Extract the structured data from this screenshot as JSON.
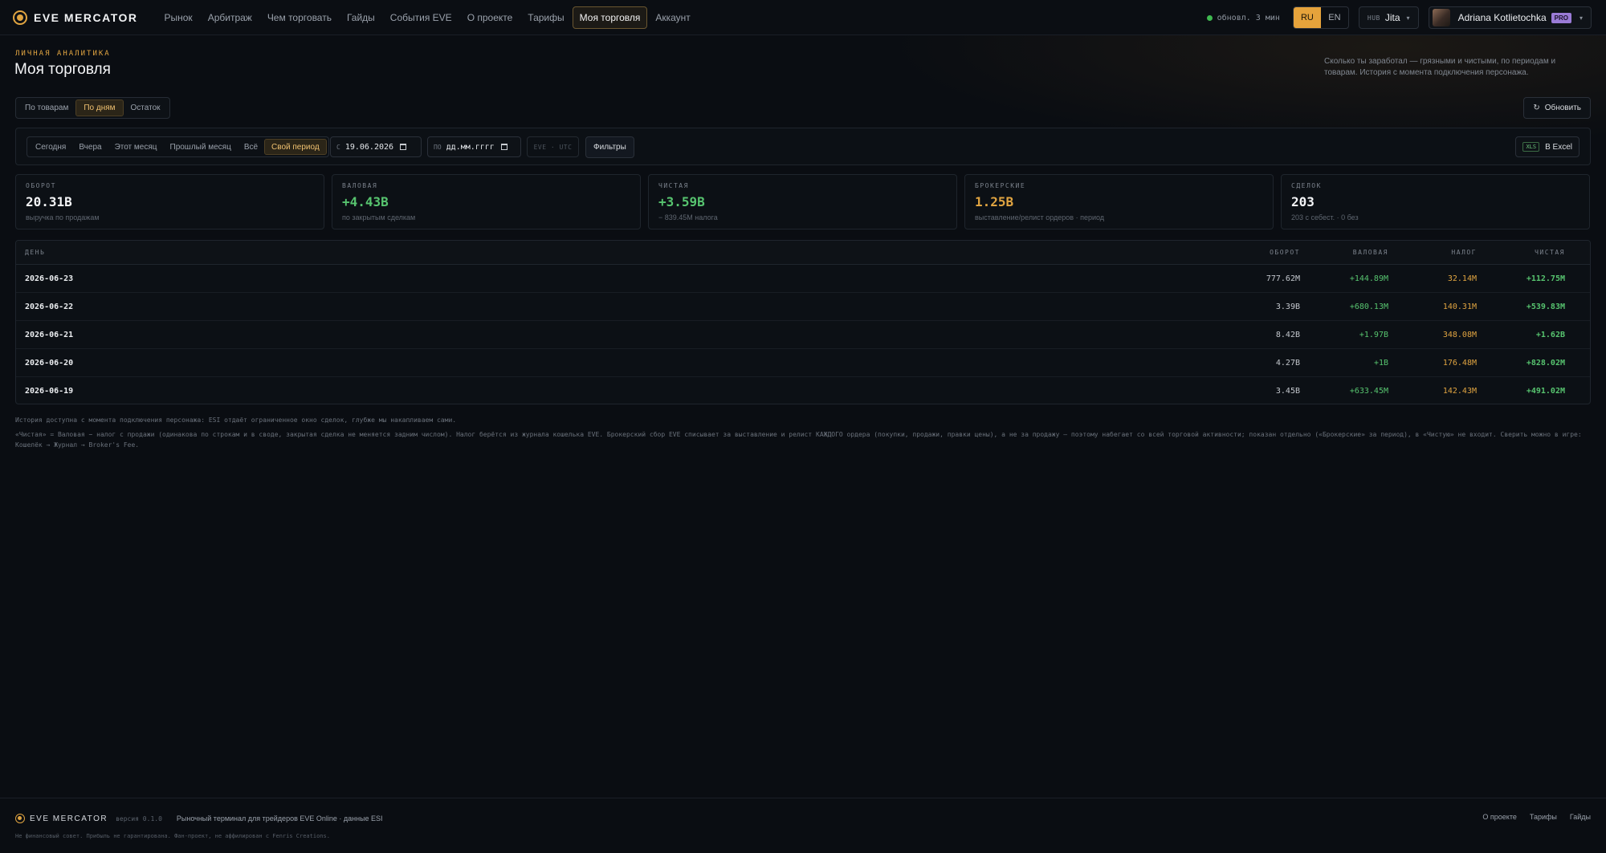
{
  "app": {
    "name": "EVE MERCATOR",
    "nav": [
      "Рынок",
      "Арбитраж",
      "Чем торговать",
      "Гайды",
      "События EVE",
      "О проекте",
      "Тарифы",
      "Моя торговля",
      "Аккаунт"
    ],
    "status": "обновл. 3 мин",
    "lang": [
      "RU",
      "EN"
    ],
    "hub_label": "HUB",
    "hub_value": "Jita",
    "user_name": "Adriana Kotlietochka",
    "user_badge": "PRO"
  },
  "header": {
    "eyebrow": "ЛИЧНАЯ АНАЛИТИКА",
    "title": "Моя торговля",
    "description": "Сколько ты заработал — грязными и чистыми, по периодам и товарам. История с момента подключения персонажа.",
    "tabs": [
      "По товарам",
      "По дням",
      "Остаток"
    ],
    "refresh_label": "Обновить"
  },
  "filters": {
    "periods": [
      "Сегодня",
      "Вчера",
      "Этот месяц",
      "Прошлый месяц",
      "Всё",
      "Свой период"
    ],
    "from_prefix": "С",
    "from_value": "19.06.2026",
    "to_prefix": "ПО",
    "to_value": "дд.мм.гггг",
    "timezone": "EVE · UTC",
    "filters_label": "Фильтры",
    "excel_badge": "XLS",
    "excel_label": "В Excel"
  },
  "stats": [
    {
      "label": "ОБОРОТ",
      "value": "20.31B",
      "sub": "выручка по продажам",
      "color": "#f4f5f7"
    },
    {
      "label": "ВАЛОВАЯ",
      "value": "+4.43B",
      "sub": "по закрытым сделкам",
      "color": "#57c46f"
    },
    {
      "label": "ЧИСТАЯ",
      "value": "+3.59B",
      "sub": "− 839.45M налога",
      "color": "#57c46f"
    },
    {
      "label": "БРОКЕРСКИЕ",
      "value": "1.25B",
      "sub": "выставление/релист ордеров · период",
      "color": "#e0a441"
    },
    {
      "label": "СДЕЛОК",
      "value": "203",
      "sub": "203 с себест. · 0 без",
      "color": "#f4f5f7"
    }
  ],
  "table": {
    "headers": {
      "day": "ДЕНЬ",
      "turnover": "ОБОРОТ",
      "gross": "ВАЛОВАЯ",
      "tax": "НАЛОГ",
      "net": "ЧИСТАЯ"
    },
    "rows": [
      {
        "day": "2026-06-23",
        "turnover": "777.62M",
        "gross": "+144.89M",
        "tax": "32.14M",
        "net": "+112.75M"
      },
      {
        "day": "2026-06-22",
        "turnover": "3.39B",
        "gross": "+680.13M",
        "tax": "140.31M",
        "net": "+539.83M"
      },
      {
        "day": "2026-06-21",
        "turnover": "8.42B",
        "gross": "+1.97B",
        "tax": "348.08M",
        "net": "+1.62B"
      },
      {
        "day": "2026-06-20",
        "turnover": "4.27B",
        "gross": "+1B",
        "tax": "176.48M",
        "net": "+828.02M"
      },
      {
        "day": "2026-06-19",
        "turnover": "3.45B",
        "gross": "+633.45M",
        "tax": "142.43M",
        "net": "+491.02M"
      }
    ]
  },
  "notes": [
    "История доступна с момента подключения персонажа: ESI отдаёт ограниченное окно сделок, глубже мы накапливаем сами.",
    "«Чистая» = Валовая − налог с продажи (одинакова по строкам и в своде, закрытая сделка не меняется задним числом). Налог берётся из журнала кошелька EVE. Брокерский сбор EVE списывает за выставление и релист КАЖДОГО ордера (покупки, продажи, правки цены), а не за продажу — поэтому набегает со всей торговой активности; показан отдельно («Брокерские» за период), в «Чистую» не входит. Сверить можно в игре: Кошелёк → Журнал → Broker's Fee."
  ],
  "footer": {
    "name": "EVE MERCATOR",
    "version": "версия 0.1.0",
    "tagline": "Рыночный терминал для трейдеров EVE Online · данные ESI",
    "links": [
      "О проекте",
      "Тарифы",
      "Гайды"
    ],
    "disclaimer": "Не финансовый совет. Прибыль не гарантирована. Фан-проект, не аффилирован с Fenris Creations."
  }
}
